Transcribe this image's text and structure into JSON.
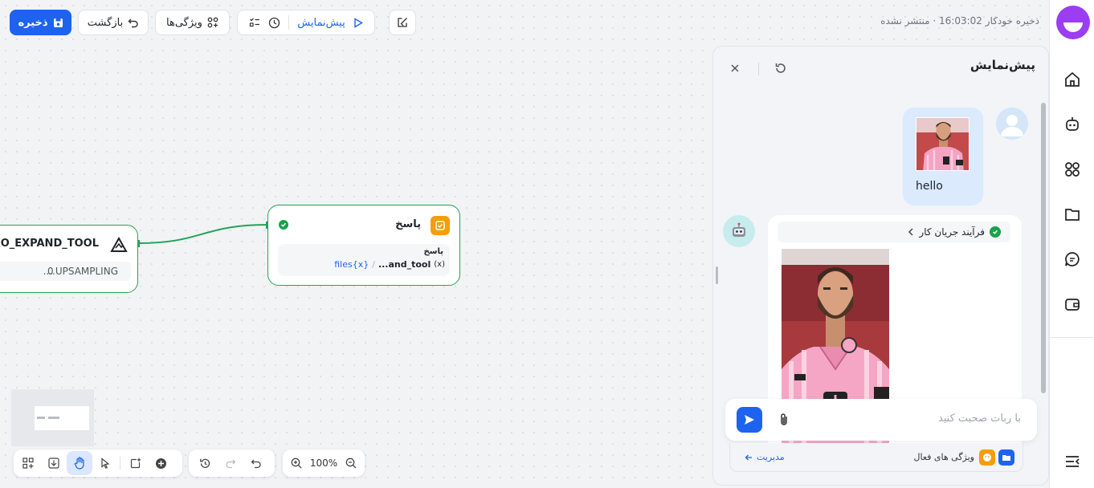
{
  "toolbar": {
    "save_label": "ذخیره",
    "back_label": "بازگشت",
    "features_label": "ویژگی‌ها",
    "preview_label": "پیش‌نمایش",
    "status_text": "ذخیره خودکار 16:03:02 · منتشر نشده"
  },
  "nodes": {
    "left": {
      "title": "PRO_EXPAND_TOOL",
      "param_value": "0",
      "param_name": "....UPSAMPLING"
    },
    "answer": {
      "title": "پاسخ",
      "field_label": "پاسخ",
      "var_tool": "...and_tool",
      "var_tool_icon": "(x)",
      "var_sep": "/",
      "var_files": "files{x}"
    }
  },
  "preview": {
    "title": "پیش‌نمایش",
    "user_message": "hello",
    "workflow_label": "فرآیند جریان کار",
    "input_placeholder": "با ربات صحبت کنید",
    "active_features_label": "ویژگی های فعال",
    "manage_label": "مدیریت"
  },
  "bottom_toolbar": {
    "zoom_level": "100%"
  },
  "icons": {
    "sidebar": [
      "home-icon",
      "robot-icon",
      "apps-icon",
      "folder-icon",
      "chat-icon",
      "wallet-icon"
    ],
    "collapse": "collapse-menu-icon"
  },
  "colors": {
    "primary": "#1e63f0",
    "node_border": "#22a35a",
    "success": "#16a34a",
    "accent_orange": "#f59e0b",
    "brand_purple": "#9b3df0"
  }
}
